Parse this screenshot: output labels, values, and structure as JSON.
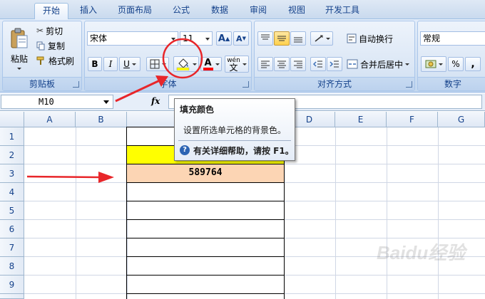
{
  "tabs": [
    {
      "label": "开始",
      "active": true
    },
    {
      "label": "插入"
    },
    {
      "label": "页面布局"
    },
    {
      "label": "公式"
    },
    {
      "label": "数据"
    },
    {
      "label": "审阅"
    },
    {
      "label": "视图"
    },
    {
      "label": "开发工具"
    }
  ],
  "clipboard": {
    "paste_label": "粘贴",
    "cut_label": "剪切",
    "copy_label": "复制",
    "format_painter_label": "格式刷",
    "group_label": "剪贴板"
  },
  "font": {
    "font_name": "宋体",
    "font_size": "11",
    "grow_font_label": "A",
    "shrink_font_label": "A",
    "bold_label": "B",
    "italic_label": "I",
    "underline_label": "U",
    "font_color_label": "A",
    "phonetic_label": "wén",
    "group_label": "字体"
  },
  "alignment": {
    "wrap_text_label": "自动换行",
    "merge_center_label": "合并后居中",
    "group_label": "对齐方式"
  },
  "number": {
    "format": "常规",
    "percent_label": "%",
    "comma_label": ",",
    "group_label": "数字"
  },
  "formula_bar": {
    "name_box": "M10",
    "fx_label": "fx"
  },
  "columns": [
    "A",
    "B",
    "C",
    "D",
    "E",
    "F",
    "G"
  ],
  "rows": [
    "1",
    "2",
    "3",
    "4",
    "5",
    "6",
    "7",
    "8",
    "9"
  ],
  "cells": {
    "C3": "589764"
  },
  "tooltip": {
    "title": "填充颜色",
    "description": "设置所选单元格的背景色。",
    "help_text": "有关详细帮助，请按 F1。"
  },
  "colors": {
    "fill_yellow": "#ffff00",
    "fill_peach": "#fcd5b4",
    "font_color_red": "#ff0000",
    "annotation_red": "#e8262a"
  },
  "watermark": "Baidu经验"
}
